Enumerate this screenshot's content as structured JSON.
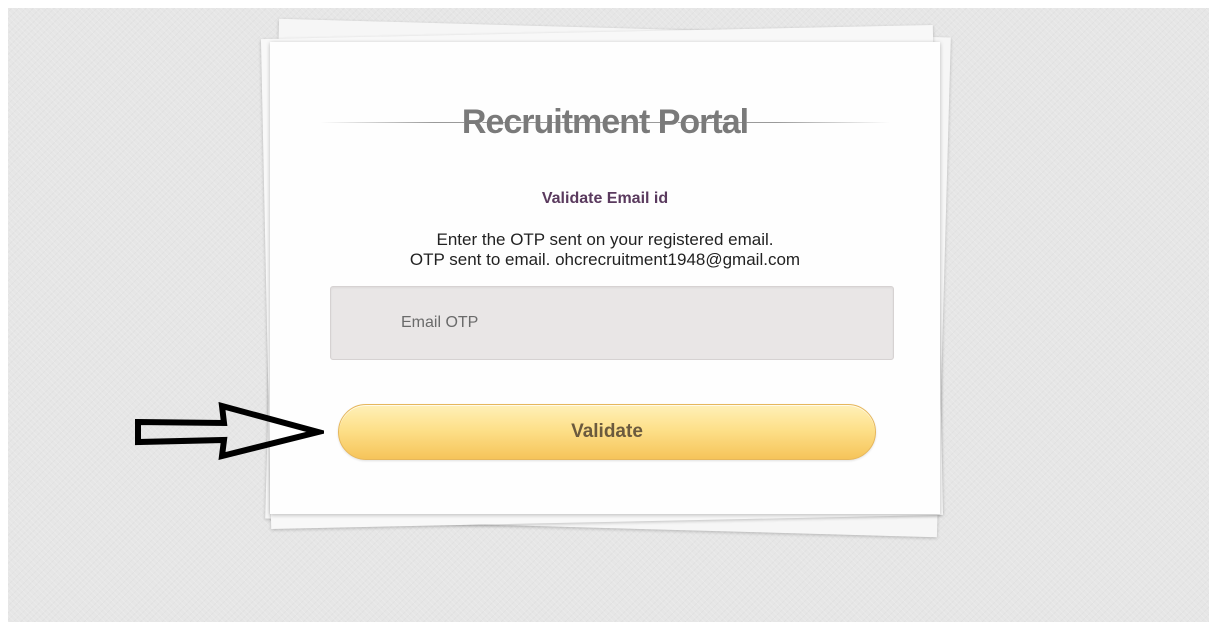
{
  "portal": {
    "title": "Recruitment Portal",
    "subtitle": "Validate Email id",
    "instruction_line1": "Enter the OTP sent on your registered email.",
    "instruction_line2": "OTP sent to email. ohcrecruitment1948@gmail.com"
  },
  "form": {
    "otp_placeholder": "Email OTP",
    "otp_value": "",
    "validate_label": "Validate"
  },
  "annotation": {
    "icon": "arrow-right-icon",
    "color": "#000000"
  },
  "colors": {
    "background": "#e6e6e6",
    "subtitle": "#5a3a5e",
    "button_top": "#fff0b8",
    "button_bottom": "#f6c45a",
    "input_bg": "#e9e6e6"
  }
}
